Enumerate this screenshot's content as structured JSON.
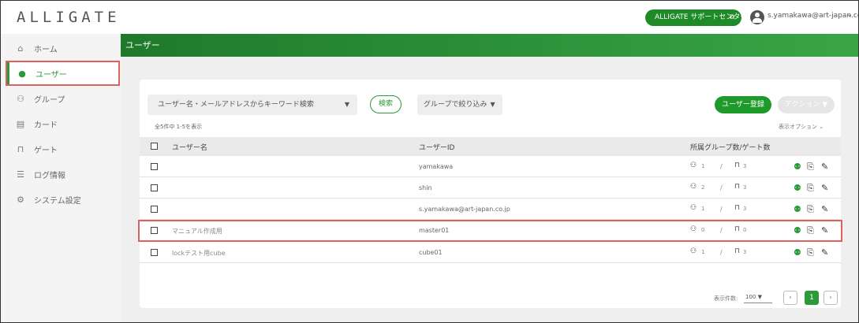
{
  "header": {
    "logo": "ALLIGATE",
    "support_label": "ALLIGATE サポートセンター",
    "email": "s.yamakawa@art-japan.co.jp"
  },
  "sidebar": {
    "items": [
      {
        "label": "ホーム",
        "icon": "home-icon"
      },
      {
        "label": "ユーザー",
        "icon": "user-icon",
        "active": true
      },
      {
        "label": "グループ",
        "icon": "group-icon"
      },
      {
        "label": "カード",
        "icon": "card-icon"
      },
      {
        "label": "ゲート",
        "icon": "gate-icon"
      },
      {
        "label": "ログ情報",
        "icon": "list-icon"
      },
      {
        "label": "システム設定",
        "icon": "gear-icon"
      }
    ]
  },
  "page": {
    "title": "ユーザー"
  },
  "toolbar": {
    "search_placeholder": "ユーザー名・メールアドレスからキーワード検索",
    "search_button": "検索",
    "group_filter": "グループで絞り込み",
    "register_button": "ユーザー登録",
    "action_button": "アクション"
  },
  "list": {
    "count_text": "全5件中 1-5を表示",
    "display_options": "表示オプション",
    "columns": {
      "name": "ユーザー名",
      "user_id": "ユーザーID",
      "groups_gates": "所属グループ数/ゲート数"
    },
    "rows": [
      {
        "name": "",
        "user_id": "yamakawa",
        "groups": "1",
        "gates": "3"
      },
      {
        "name": "",
        "user_id": "shin",
        "groups": "2",
        "gates": "3"
      },
      {
        "name": "",
        "user_id": "s.yamakawa@art-japan.co.jp",
        "groups": "1",
        "gates": "3"
      },
      {
        "name": "マニュアル作成用",
        "user_id": "master01",
        "groups": "0",
        "gates": "0"
      },
      {
        "name": "lockテスト用cube",
        "user_id": "cube01",
        "groups": "1",
        "gates": "3"
      }
    ]
  },
  "pagination": {
    "per_page_label": "表示件数:",
    "per_page_value": "100",
    "current_page": "1"
  },
  "colors": {
    "accent": "#2a9a3a",
    "highlight": "#e06060"
  }
}
